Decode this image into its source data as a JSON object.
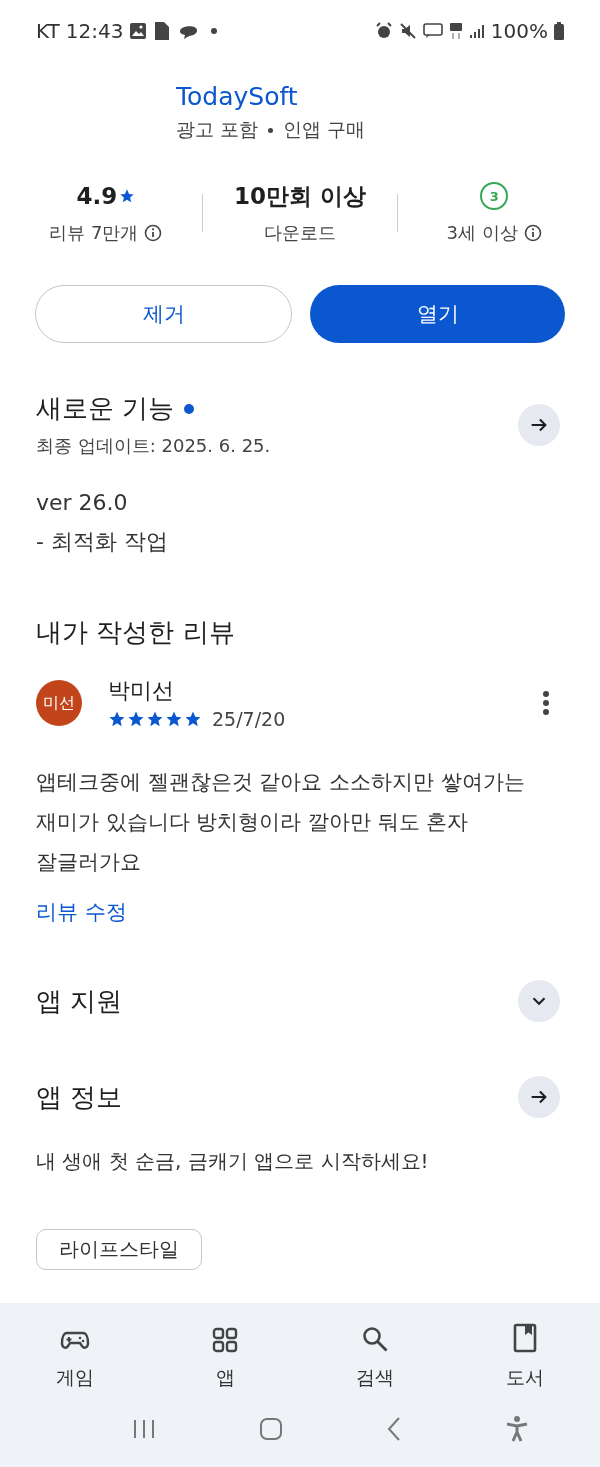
{
  "status_bar": {
    "carrier": "KT",
    "time": "12:43",
    "battery": "100%"
  },
  "app": {
    "developer": "TodaySoft",
    "notes": [
      "광고 포함",
      "인앱 구매"
    ]
  },
  "stats": [
    {
      "kind": "rating",
      "value": "4.9",
      "label": "리뷰 7만개",
      "info": true
    },
    {
      "kind": "text",
      "value": "10만회 이상",
      "label": "다운로드",
      "info": false
    },
    {
      "kind": "age",
      "value": "3",
      "label": "3세 이상",
      "info": true
    }
  ],
  "buttons": [
    {
      "label": "제거",
      "kind": "outline"
    },
    {
      "label": "열기",
      "kind": "filled"
    }
  ],
  "whats_new": {
    "title": "새로운 기능",
    "new_dot": true,
    "updated": "최종 업데이트: 2025. 6. 25.",
    "lines": [
      "ver 26.0",
      "- 최적화 작업"
    ]
  },
  "my_review": {
    "title": "내가 작성한 리뷰",
    "avatar": "미선",
    "color": "#c1441a",
    "name": "박미선",
    "stars": 5,
    "date": "25/7/20",
    "text": "앱테크중에 젤괜찮은것 같아요 소소하지만 쌓여가는 재미가 있습니다 방치형이라 깔아만 둬도 혼자 잘글러가요",
    "edit": "리뷰 수정"
  },
  "sections": [
    {
      "title": "앱 지원",
      "kind": "expand"
    },
    {
      "title": "앱 정보",
      "kind": "arrow",
      "description": "내 생애 첫 순금, 금캐기 앱으로 시작하세요!"
    }
  ],
  "chips": [
    "라이프스타일"
  ],
  "nav": [
    {
      "label": "게임",
      "kind": "games"
    },
    {
      "label": "앱",
      "kind": "apps"
    },
    {
      "label": "검색",
      "kind": "search"
    },
    {
      "label": "도서",
      "kind": "books"
    }
  ]
}
